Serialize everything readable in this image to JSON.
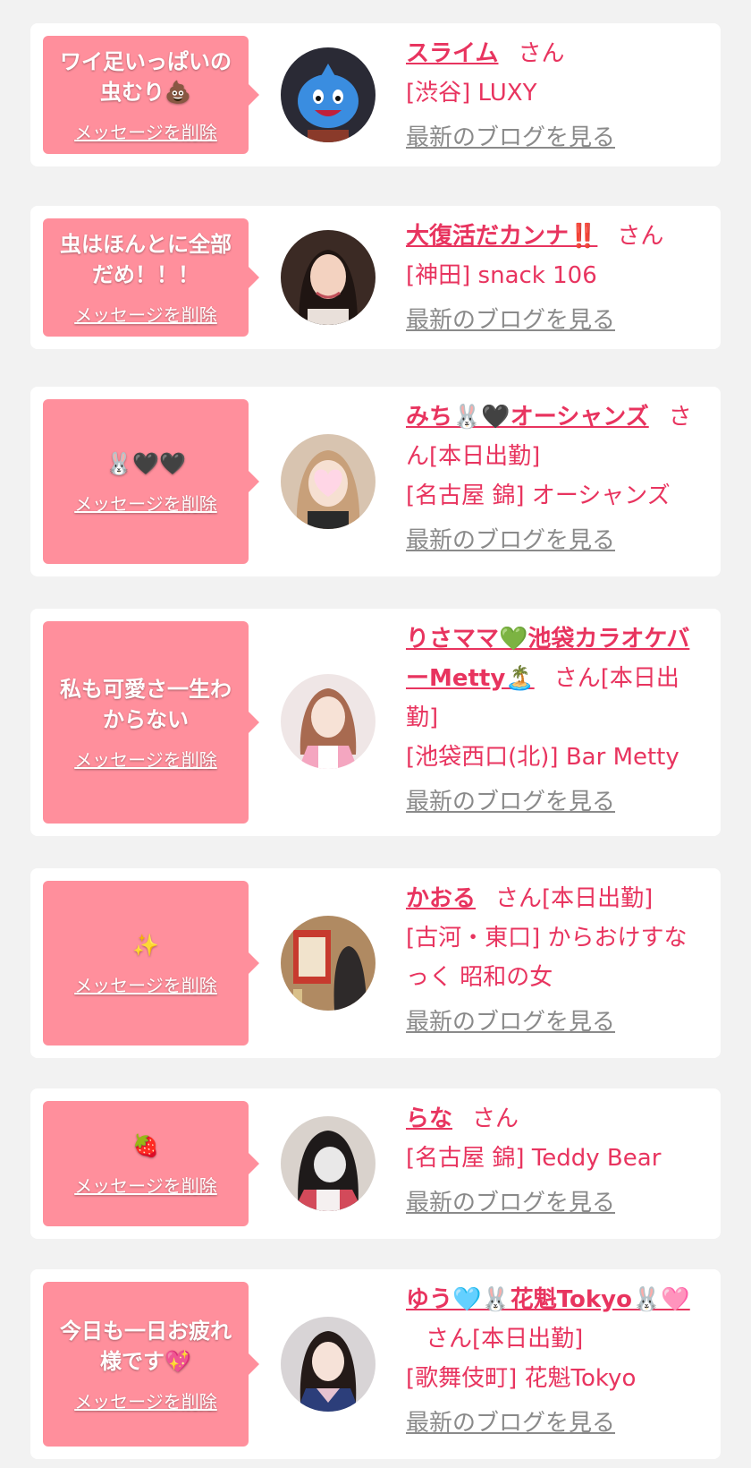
{
  "delete_label": "メッセージを削除",
  "san_label": "さん",
  "blog_label": "最新のブログを見る",
  "colors": {
    "bubble": "#ff8f9c",
    "accent": "#e8345f",
    "link_gray": "#8a8a8a",
    "background": "#f2f2f2"
  },
  "items": [
    {
      "message": "ワイ足いっぱいの虫むり💩",
      "name": "スライム",
      "suffix": "",
      "shop": "[渋谷] LUXY",
      "avatar": "slime-avatar"
    },
    {
      "message": "虫はほんとに全部だめ！！！",
      "name": "大復活だカンナ‼️",
      "suffix": "",
      "shop": "[神田] snack 106",
      "avatar": "woman-avatar"
    },
    {
      "message": "🐰🖤🖤",
      "name": "みち🐰🖤オーシャンズ",
      "suffix": "[本日出勤]",
      "shop": "[名古屋 錦] オーシャンズ",
      "avatar": "heart-blur-avatar"
    },
    {
      "message": "私も可愛さ一生わからない",
      "name": "りさママ💚池袋カラオケバーMetty🏝️",
      "suffix": "[本日出勤]",
      "shop": "[池袋西口(北)] Bar Metty",
      "avatar": "woman-avatar"
    },
    {
      "message": "✨",
      "name": "かおる",
      "suffix": "[本日出勤]",
      "shop": "[古河・東口] からおけすなっく 昭和の女",
      "avatar": "poster-avatar"
    },
    {
      "message": "🍓",
      "name": "らな",
      "suffix": "",
      "shop": "[名古屋 錦] Teddy Bear",
      "avatar": "blur-avatar"
    },
    {
      "message": "今日も一日お疲れ様です💖",
      "name": "ゆう🩵🐰花魁Tokyo🐰🩷",
      "suffix": "[本日出勤]",
      "shop": "[歌舞伎町] 花魁Tokyo",
      "avatar": "woman-avatar"
    }
  ]
}
